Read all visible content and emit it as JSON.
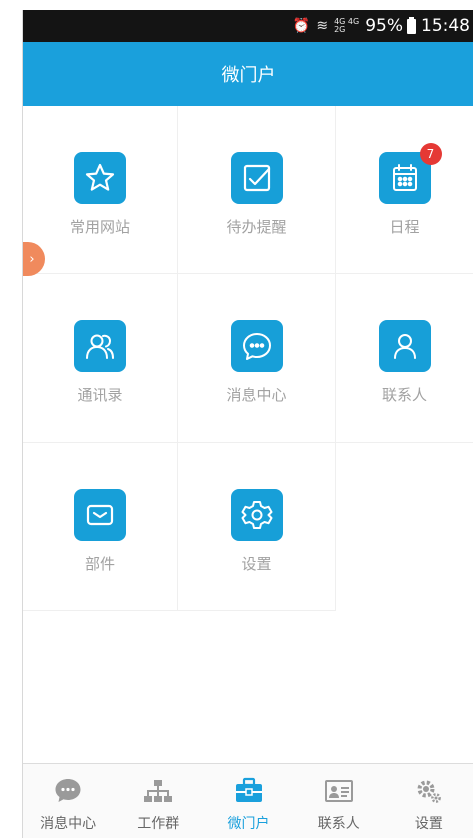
{
  "status_bar": {
    "network_top": "4G",
    "network_mid": "4G",
    "network_bottom": "2G",
    "battery": "95%",
    "time": "15:48"
  },
  "header": {
    "title": "微门户"
  },
  "grid_items": [
    {
      "label": "常用网站",
      "icon": "star-icon"
    },
    {
      "label": "待办提醒",
      "icon": "checkbox-icon"
    },
    {
      "label": "日程",
      "icon": "calendar-icon",
      "badge": "7"
    },
    {
      "label": "通讯录",
      "icon": "contacts-icon"
    },
    {
      "label": "消息中心",
      "icon": "chat-bubble-icon"
    },
    {
      "label": "联系人",
      "icon": "person-icon"
    },
    {
      "label": "部件",
      "icon": "mail-icon"
    },
    {
      "label": "设置",
      "icon": "gear-icon"
    }
  ],
  "tabbar": [
    {
      "label": "消息中心",
      "icon": "chat-bubble-icon"
    },
    {
      "label": "工作群",
      "icon": "org-chart-icon"
    },
    {
      "label": "微门户",
      "icon": "briefcase-icon",
      "active": true
    },
    {
      "label": "联系人",
      "icon": "contact-card-icon"
    },
    {
      "label": "设置",
      "icon": "gears-icon"
    }
  ],
  "colors": {
    "accent": "#1aa0dc",
    "tile": "#179fd8",
    "badge": "#e53935",
    "float_button": "#f08a5d"
  }
}
